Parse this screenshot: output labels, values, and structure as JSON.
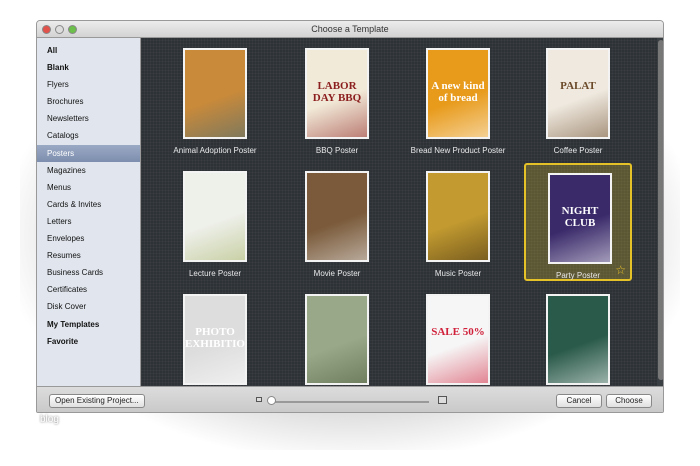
{
  "window": {
    "title": "Choose a Template"
  },
  "sidebar": {
    "items": [
      {
        "label": "All",
        "bold": true
      },
      {
        "label": "Blank",
        "bold": true
      },
      {
        "label": "Flyers"
      },
      {
        "label": "Brochures"
      },
      {
        "label": "Newsletters"
      },
      {
        "label": "Catalogs"
      },
      {
        "label": "Posters",
        "selected": true
      },
      {
        "label": "Magazines"
      },
      {
        "label": "Menus"
      },
      {
        "label": "Cards & Invites"
      },
      {
        "label": "Letters"
      },
      {
        "label": "Envelopes"
      },
      {
        "label": "Resumes"
      },
      {
        "label": "Business Cards"
      },
      {
        "label": "Certificates"
      },
      {
        "label": "Disk Cover"
      },
      {
        "label": "My Templates",
        "bold": true
      },
      {
        "label": "Favorite",
        "bold": true
      }
    ]
  },
  "templates": [
    {
      "label": "Animal Adoption Poster",
      "bg": "#c98a3a",
      "fg": "#3f6a7a",
      "text": ""
    },
    {
      "label": "BBQ Poster",
      "bg": "#f2ead8",
      "fg": "#8b1e1e",
      "text": "LABOR DAY BBQ"
    },
    {
      "label": "Bread New Product Poster",
      "bg": "#e89a1a",
      "fg": "#fff",
      "text": "A new kind of bread"
    },
    {
      "label": "Coffee Poster",
      "bg": "#efe9df",
      "fg": "#6b4a2a",
      "text": "PALAT"
    },
    {
      "label": "Lecture Poster",
      "bg": "#eef0ea",
      "fg": "#a8b56a",
      "text": ""
    },
    {
      "label": "Movie Poster",
      "bg": "#7a5a3a",
      "fg": "#eee",
      "text": ""
    },
    {
      "label": "Music Poster",
      "bg": "#c29a30",
      "fg": "#3a2a10",
      "text": ""
    },
    {
      "label": "Party Poster",
      "bg": "#3a2a6a",
      "fg": "#fff",
      "text": "NIGHT CLUB",
      "selected": true
    },
    {
      "label": "",
      "bg": "#ddd",
      "fg": "#fff",
      "text": "PHOTO EXHIBITION"
    },
    {
      "label": "",
      "bg": "#9aa88a",
      "fg": "#4a5a3a",
      "text": ""
    },
    {
      "label": "",
      "bg": "#f6f6f6",
      "fg": "#d0203a",
      "text": "SALE 50%"
    },
    {
      "label": "",
      "bg": "#2a5a4a",
      "fg": "#fff",
      "text": ""
    }
  ],
  "footer": {
    "open_label": "Open Existing Project...",
    "cancel_label": "Cancel",
    "choose_label": "Choose",
    "thumb_size": 0.0
  },
  "watermark": "blog"
}
